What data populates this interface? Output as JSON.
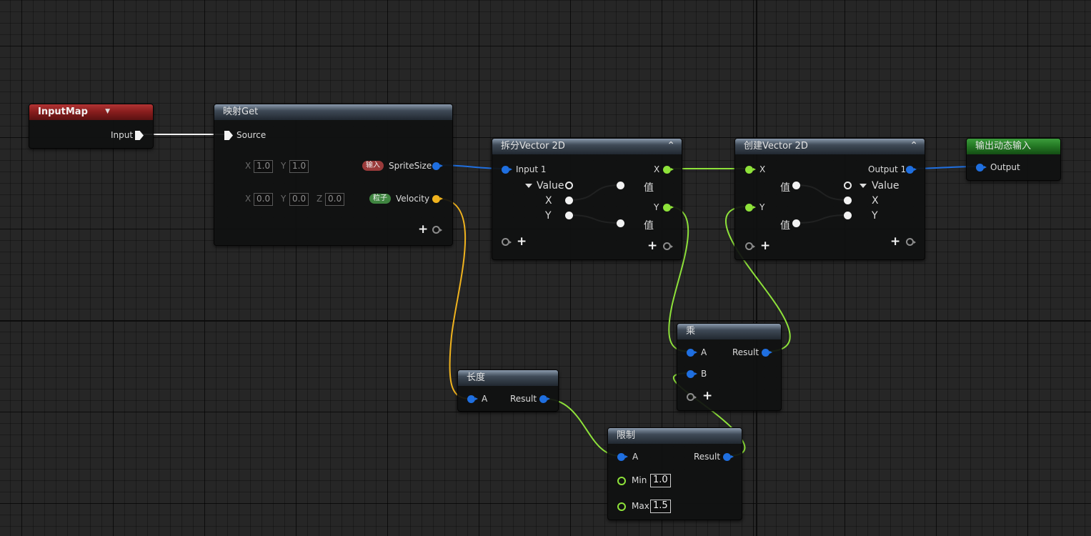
{
  "colors": {
    "wire_blue": "#1f6fe0",
    "wire_yellow": "#f0b31e",
    "wire_lime": "#8ee23a",
    "wire_white": "#f2f2f2",
    "header_red": "#8a1e1e",
    "header_green": "#257a25",
    "header_slate": "#3f4a57"
  },
  "input_map": {
    "title": "InputMap",
    "input_label": "Input"
  },
  "map_get": {
    "title": "映射Get",
    "source_label": "Source",
    "sprite_size": {
      "tag": "输入",
      "label": "SpriteSize",
      "x": "1.0",
      "y": "1.0"
    },
    "velocity": {
      "tag": "粒子",
      "label": "Velocity",
      "x": "0.0",
      "y": "0.0",
      "z": "0.0"
    },
    "axis_x": "X",
    "axis_y": "Y",
    "axis_z": "Z"
  },
  "break_vector": {
    "title": "拆分Vector 2D",
    "input1": "Input 1",
    "value": "Value",
    "x": "X",
    "y": "Y",
    "out_x": "X",
    "out_y": "Y",
    "val_top": "值",
    "val_bottom": "值"
  },
  "make_vector": {
    "title": "创建Vector 2D",
    "in_x": "X",
    "in_y": "Y",
    "val_top": "值",
    "val_bottom": "值",
    "output1": "Output 1",
    "value": "Value",
    "x": "X",
    "y": "Y"
  },
  "output_node": {
    "title": "输出动态输入",
    "output_label": "Output"
  },
  "multiply": {
    "title": "乘",
    "a": "A",
    "b": "B",
    "result": "Result"
  },
  "length": {
    "title": "长度",
    "a": "A",
    "result": "Result"
  },
  "clamp": {
    "title": "限制",
    "a": "A",
    "result": "Result",
    "min_label": "Min",
    "min_value": "1.0",
    "max_label": "Max",
    "max_value": "1.5"
  },
  "icons": {
    "dropdown": "▼",
    "collapse": "⌃",
    "plus": "+"
  }
}
